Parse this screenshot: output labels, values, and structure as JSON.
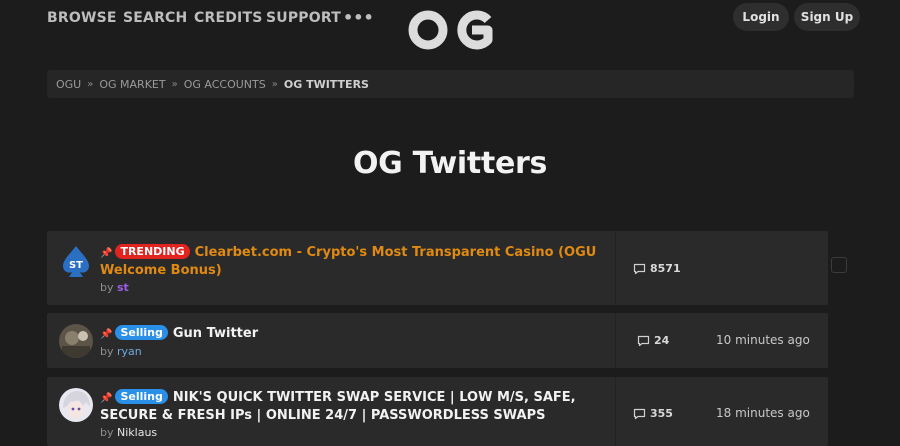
{
  "header": {
    "nav": [
      "BROWSE",
      "SEARCH",
      "CREDITS",
      "SUPPORT"
    ],
    "more": "•••",
    "logo_icon": "og-logo",
    "login_label": "Login",
    "signup_label": "Sign Up"
  },
  "breadcrumb": {
    "items": [
      "OGU",
      "OG MARKET",
      "OG ACCOUNTS",
      "OG TWITTERS"
    ],
    "separator": "»"
  },
  "page_title": "OG Twitters",
  "threads": [
    {
      "badge": "TRENDING",
      "title": "Clearbet.com - Crypto's Most Transparent Casino (OGU Welcome Bonus)",
      "by": "by",
      "author": "st",
      "replies": "8571",
      "last_post": ""
    },
    {
      "badge": "Selling",
      "title": "Gun Twitter",
      "by": "by",
      "author": "ryan",
      "replies": "24",
      "last_post": "10 minutes ago"
    },
    {
      "badge": "Selling",
      "title": "NIK'S QUICK TWITTER SWAP SERVICE | LOW M/S, SAFE, SECURE & FRESH IPs | ONLINE 24/7 | PASSWORDLESS SWAPS",
      "by": "by",
      "author": "Niklaus",
      "replies": "355",
      "last_post": "18 minutes ago"
    }
  ],
  "colors": {
    "background": "#1c1c1c",
    "trending_badge": "#e22420",
    "selling_badge": "#2a8fe6",
    "trending_title": "#e08a12"
  }
}
